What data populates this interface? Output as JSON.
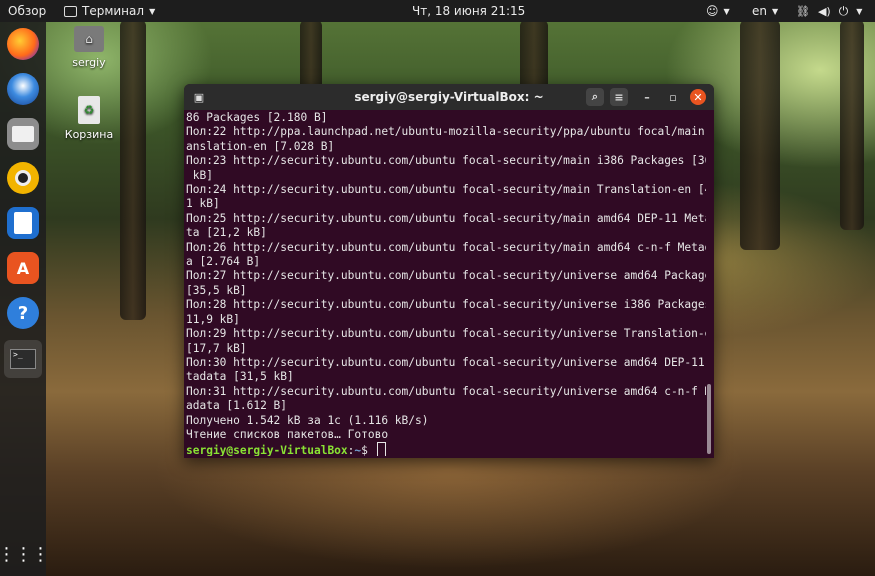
{
  "topbar": {
    "overview": "Обзор",
    "app_menu": "Терминал",
    "clock": "Чт, 18 июня  21:15",
    "language": "en"
  },
  "desktop": {
    "home_label": "sergiy",
    "trash_label": "Корзина"
  },
  "dock": {
    "items": [
      "firefox-icon",
      "thunderbird-icon",
      "files-icon",
      "rhythmbox-icon",
      "writer-icon",
      "software-icon",
      "help-icon",
      "terminal-icon",
      "apps-grid-icon"
    ]
  },
  "terminal": {
    "title": "sergiy@sergiy-VirtualBox: ~",
    "lines": [
      "86 Packages [2.180 B]",
      "Пол:22 http://ppa.launchpad.net/ubuntu-mozilla-security/ppa/ubuntu focal/main Tr",
      "anslation-en [7.028 B]",
      "Пол:23 http://security.ubuntu.com/ubuntu focal-security/main i386 Packages [36,9",
      " kB]",
      "Пол:24 http://security.ubuntu.com/ubuntu focal-security/main Translation-en [40,",
      "1 kB]",
      "Пол:25 http://security.ubuntu.com/ubuntu focal-security/main amd64 DEP-11 Metada",
      "ta [21,2 kB]",
      "Пол:26 http://security.ubuntu.com/ubuntu focal-security/main amd64 c-n-f Metadat",
      "a [2.764 B]",
      "Пол:27 http://security.ubuntu.com/ubuntu focal-security/universe amd64 Packages",
      "[35,5 kB]",
      "Пол:28 http://security.ubuntu.com/ubuntu focal-security/universe i386 Packages [",
      "11,9 kB]",
      "Пол:29 http://security.ubuntu.com/ubuntu focal-security/universe Translation-en",
      "[17,7 kB]",
      "Пол:30 http://security.ubuntu.com/ubuntu focal-security/universe amd64 DEP-11 Me",
      "tadata [31,5 kB]",
      "Пол:31 http://security.ubuntu.com/ubuntu focal-security/universe amd64 c-n-f Met",
      "adata [1.612 B]",
      "Получено 1.542 kB за 1с (1.116 kB/s)",
      "Чтение списков пакетов… Готово"
    ],
    "prompt_user": "sergiy@sergiy-VirtualBox",
    "prompt_sep": ":",
    "prompt_path": "~",
    "prompt_symbol": "$ "
  }
}
